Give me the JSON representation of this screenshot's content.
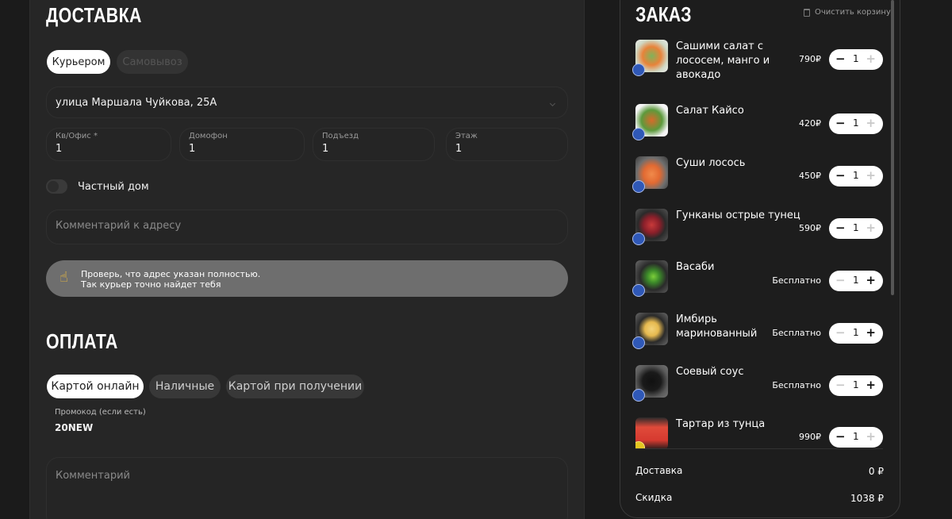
{
  "delivery": {
    "title": "ДОСТАВКА",
    "method_courier": "Курьером",
    "method_pickup": "Самовывоз",
    "address": "улица Маршала Чуйкова, 25А",
    "fields": [
      {
        "label": "Кв/Офис *",
        "value": "1"
      },
      {
        "label": "Домофон",
        "value": "1"
      },
      {
        "label": "Подъезд",
        "value": "1"
      },
      {
        "label": "Этаж",
        "value": "1"
      }
    ],
    "private_house_label": "Частный дом",
    "private_house_on": false,
    "address_comment_placeholder": "Комментарий к адресу",
    "hint_line1": "Проверь, что адрес указан полностью.",
    "hint_line2": "Так курьер точно найдет тебя"
  },
  "payment": {
    "title": "ОПЛАТА",
    "options": [
      "Картой онлайн",
      "Наличные",
      "Картой при получении"
    ],
    "selected": "Картой онлайн",
    "promo_label": "Промокод (если есть)",
    "promo_value": "20NEW",
    "comment_placeholder": "Комментарий"
  },
  "order": {
    "title": "ЗАКАЗ",
    "clear_label": "Очистить корзину",
    "items": [
      {
        "name": "Сашими салат с лососем, манго и авокадо",
        "price": "790₽",
        "qty": "1"
      },
      {
        "name": "Салат Кайсо",
        "price": "420₽",
        "qty": "1"
      },
      {
        "name": "Суши лосось",
        "price": "450₽",
        "qty": "1"
      },
      {
        "name": "Гунканы острые тунец",
        "price": "590₽",
        "qty": "1"
      },
      {
        "name": "Васаби",
        "price": "Бесплатно",
        "qty": "1"
      },
      {
        "name": "Имбирь маринованный",
        "price": "Бесплатно",
        "qty": "1"
      },
      {
        "name": "Соевый соус",
        "price": "Бесплатно",
        "qty": "1"
      },
      {
        "name": "Тартар из тунца",
        "price": "990₽",
        "qty": "1"
      }
    ],
    "delivery_label": "Доставка",
    "delivery_value": "0 ₽",
    "discount_label": "Скидка",
    "discount_value": "1038 ₽"
  },
  "icons": {
    "hint": "hand-pointing-icon",
    "clear": "trash-icon",
    "minus": "minus-icon",
    "plus": "plus-icon"
  },
  "colors": {
    "background": "#1b1b1b",
    "panel": "#262626",
    "accent_badge": "#2f58b7",
    "hint_bg": "#6e6e6e"
  }
}
